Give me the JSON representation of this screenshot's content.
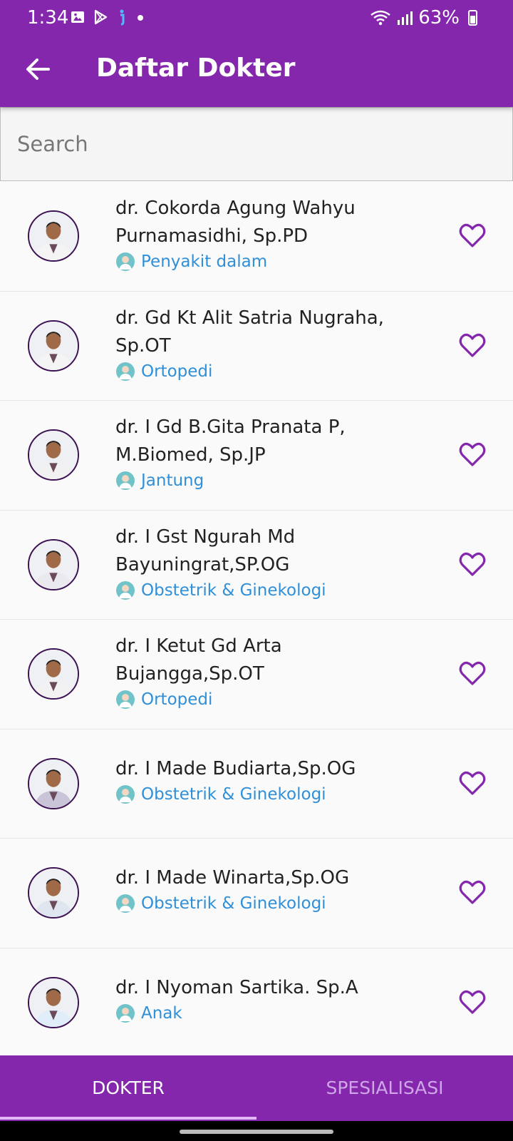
{
  "status": {
    "time": "1:34",
    "battery": "63%"
  },
  "appbar": {
    "title": "Daftar Dokter"
  },
  "search": {
    "placeholder": "Search"
  },
  "doctors": [
    {
      "name_line1": "dr. Cokorda Agung Wahyu",
      "name_line2": "Purnamasidhi, Sp.PD",
      "specialty": "Penyakit dalam"
    },
    {
      "name_line1": "dr. Gd Kt Alit Satria Nugraha,",
      "name_line2": "Sp.OT",
      "specialty": "Ortopedi"
    },
    {
      "name_line1": "dr. I Gd B.Gita Pranata P,",
      "name_line2": "M.Biomed, Sp.JP",
      "specialty": "Jantung"
    },
    {
      "name_line1": "dr. I Gst Ngurah Md",
      "name_line2": "Bayuningrat,SP.OG",
      "specialty": "Obstetrik & Ginekologi"
    },
    {
      "name_line1": "dr. I Ketut Gd Arta",
      "name_line2": "Bujangga,Sp.OT",
      "specialty": "Ortopedi"
    },
    {
      "name_line1": "dr. I Made Budiarta,Sp.OG",
      "name_line2": "",
      "specialty": "Obstetrik & Ginekologi"
    },
    {
      "name_line1": "dr. I Made Winarta,Sp.OG",
      "name_line2": "",
      "specialty": "Obstetrik & Ginekologi"
    },
    {
      "name_line1": "dr. I Nyoman Sartika. Sp.A",
      "name_line2": "",
      "specialty": "Anak"
    }
  ],
  "tabs": [
    {
      "label": "DOKTER"
    },
    {
      "label": "SPESIALISASI"
    }
  ],
  "colors": {
    "primary": "#8427ad",
    "specialty_text": "#2f8fd8",
    "heart": "#8427ad"
  }
}
